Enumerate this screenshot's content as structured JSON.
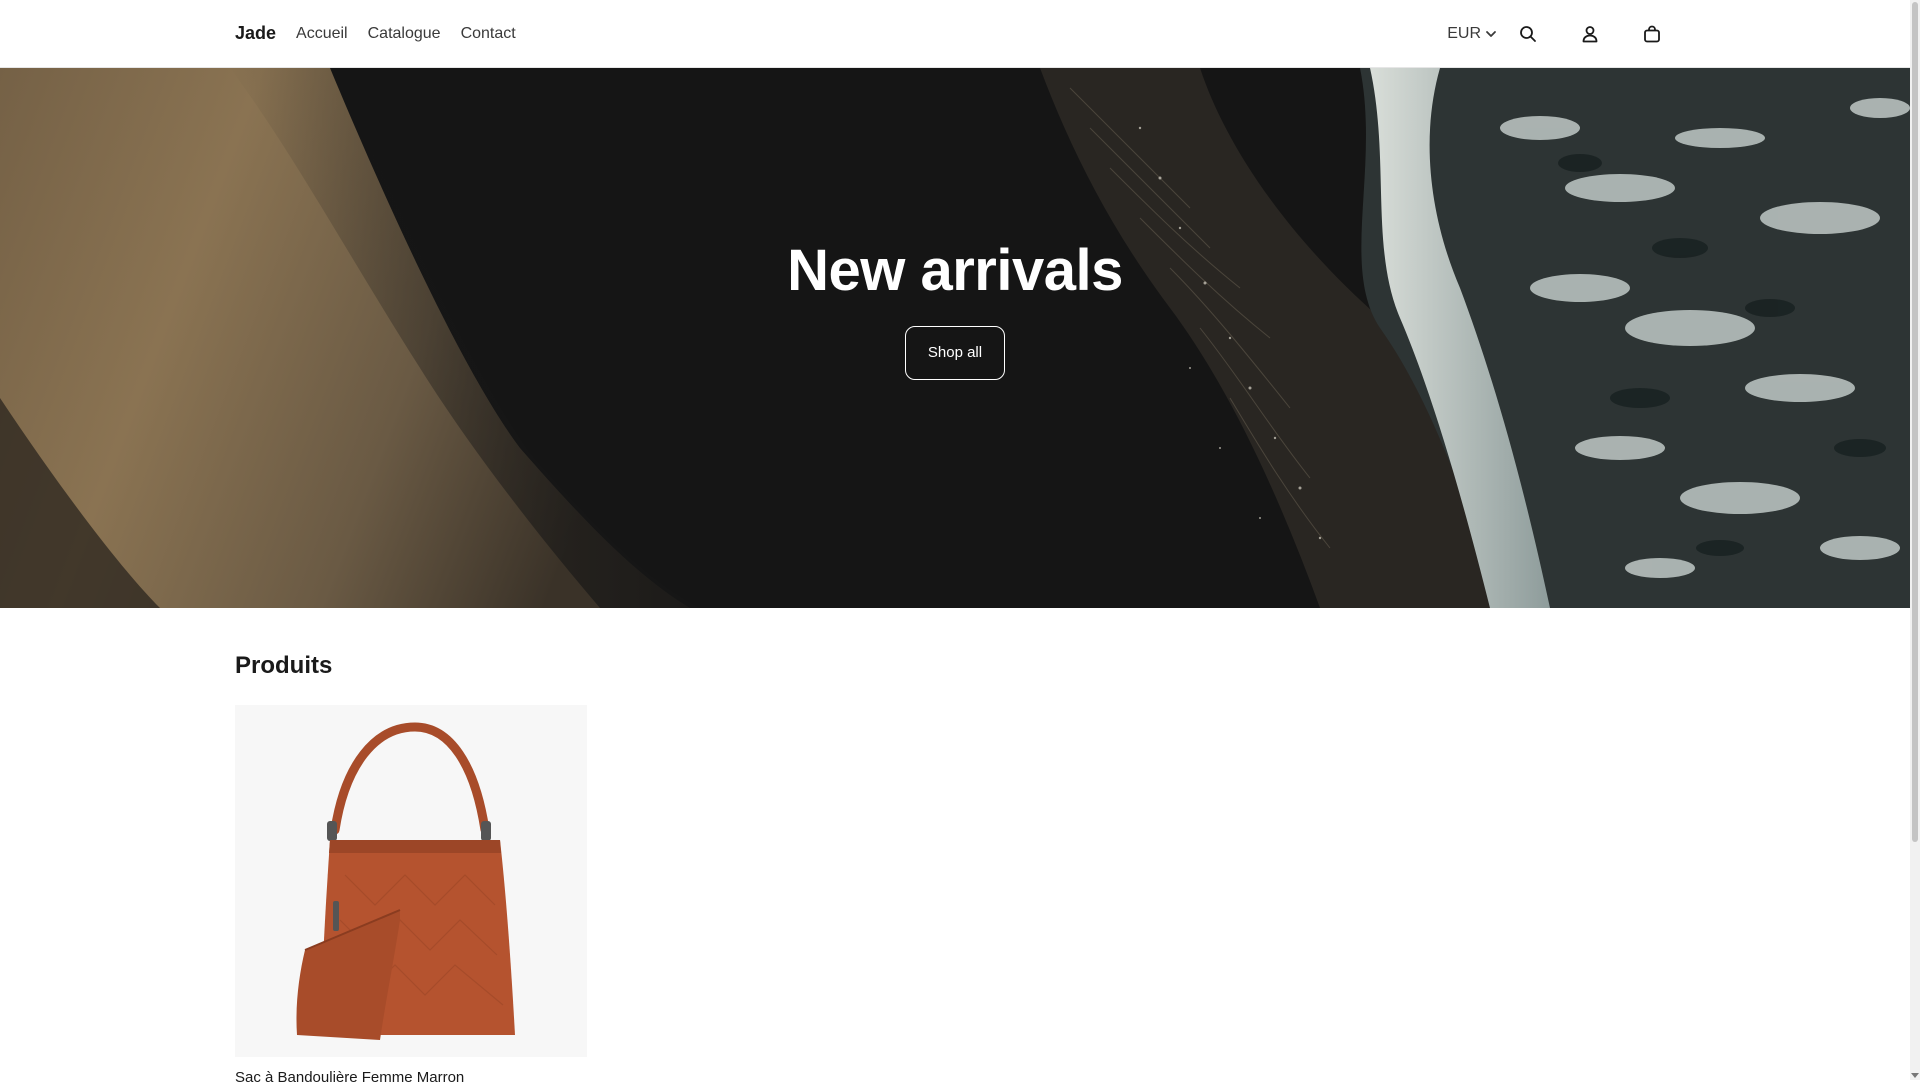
{
  "header": {
    "brand": "Jade",
    "nav": [
      {
        "label": "Accueil"
      },
      {
        "label": "Catalogue"
      },
      {
        "label": "Contact"
      }
    ],
    "currency": "EUR",
    "icons": [
      "search-icon",
      "account-icon",
      "cart-icon",
      "chevron-down-icon"
    ]
  },
  "hero": {
    "title": "New arrivals",
    "button_label": "Shop all"
  },
  "products": {
    "title": "Produits",
    "items": [
      {
        "name": "Sac à Bandoulière Femme Marron",
        "image_color": "#b5532f"
      }
    ]
  },
  "colors": {
    "text": "#1a1a1a",
    "hero_sand": "#8a7352",
    "hero_water": "#151515",
    "foam": "#e6ecea",
    "bag": "#b5532f"
  }
}
